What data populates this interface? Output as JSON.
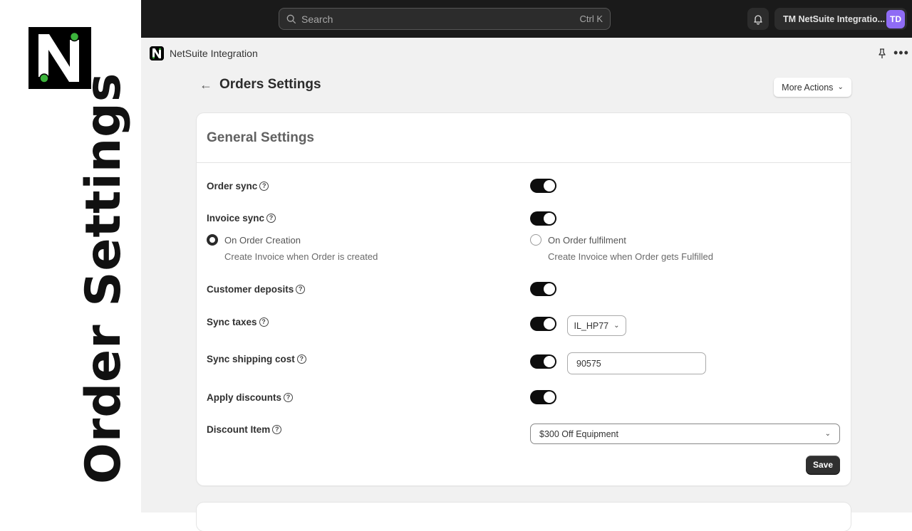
{
  "side_title": "Order Settings",
  "topbar": {
    "search_placeholder": "Search",
    "search_shortcut": "Ctrl K",
    "account_name": "TM NetSuite Integratio...",
    "avatar_initials": "TD"
  },
  "appbar": {
    "app_name": "NetSuite Integration",
    "more_label": "•••"
  },
  "page": {
    "back_arrow": "←",
    "title": "Orders Settings",
    "more_actions_label": "More Actions"
  },
  "general": {
    "title": "General Settings",
    "help_glyph": "?",
    "rows": {
      "order_sync": {
        "label": "Order sync",
        "enabled": true
      },
      "invoice_sync": {
        "label": "Invoice sync",
        "enabled": true,
        "options": [
          {
            "label": "On Order Creation",
            "description": "Create Invoice when Order is created",
            "selected": true
          },
          {
            "label": "On Order fulfilment",
            "description": "Create Invoice when Order gets Fulfilled",
            "selected": false
          }
        ]
      },
      "customer_deposits": {
        "label": "Customer deposits",
        "enabled": true
      },
      "sync_taxes": {
        "label": "Sync taxes",
        "enabled": true,
        "tax_code": "IL_HP77"
      },
      "sync_shipping_cost": {
        "label": "Sync shipping cost",
        "enabled": true,
        "value": "90575"
      },
      "apply_discounts": {
        "label": "Apply discounts",
        "enabled": true
      },
      "discount_item": {
        "label": "Discount Item",
        "value": "$300 Off Equipment"
      }
    },
    "save_label": "Save"
  },
  "colors": {
    "avatar": "#8f6cf5",
    "logo_dot": "#3cb43c",
    "toggle_on": "#0d0d0d"
  }
}
